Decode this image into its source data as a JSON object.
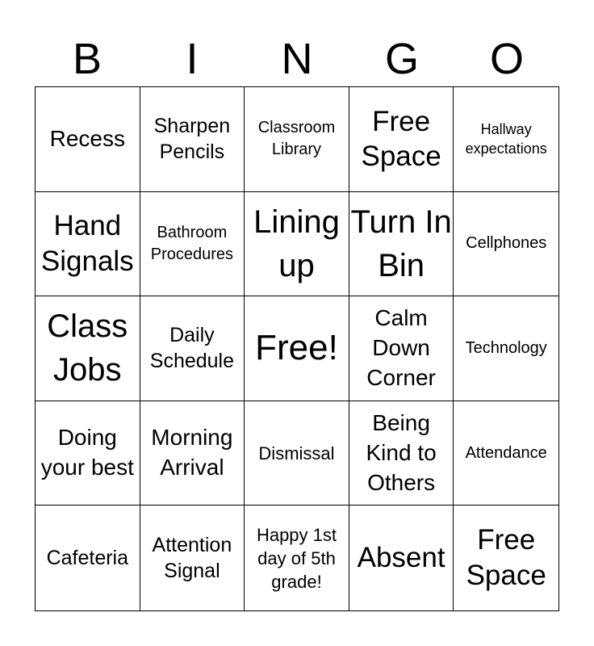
{
  "header": {
    "letters": [
      "B",
      "I",
      "N",
      "G",
      "O"
    ]
  },
  "cells": [
    {
      "text": "Recess",
      "size": "s27"
    },
    {
      "text": "Sharpen Pencils",
      "size": "s24"
    },
    {
      "text": "Classroom Library",
      "size": "s20"
    },
    {
      "text": "Free Space",
      "size": "s32"
    },
    {
      "text": "Hallway expectations",
      "size": "s18"
    },
    {
      "text": "Hand Signals",
      "size": "s32"
    },
    {
      "text": "Bathroom Procedures",
      "size": "s20"
    },
    {
      "text": "Lining up",
      "size": "s40"
    },
    {
      "text": "Turn In Bin",
      "size": "s40"
    },
    {
      "text": "Cellphones",
      "size": "s20"
    },
    {
      "text": "Class Jobs",
      "size": "s40"
    },
    {
      "text": "Daily Schedule",
      "size": "s24"
    },
    {
      "text": "Free!",
      "size": "s44"
    },
    {
      "text": "Calm Down Corner",
      "size": "s27"
    },
    {
      "text": "Technology",
      "size": "s20"
    },
    {
      "text": "Doing your best",
      "size": "s27"
    },
    {
      "text": "Morning Arrival",
      "size": "s27"
    },
    {
      "text": "Dismissal",
      "size": "s22"
    },
    {
      "text": "Being Kind to Others",
      "size": "s27"
    },
    {
      "text": "Attendance",
      "size": "s20"
    },
    {
      "text": "Cafeteria",
      "size": "s24"
    },
    {
      "text": "Attention Signal",
      "size": "s24"
    },
    {
      "text": "Happy 1st day of 5th grade!",
      "size": "s22"
    },
    {
      "text": "Absent",
      "size": "s32"
    },
    {
      "text": "Free Space",
      "size": "s32"
    }
  ]
}
